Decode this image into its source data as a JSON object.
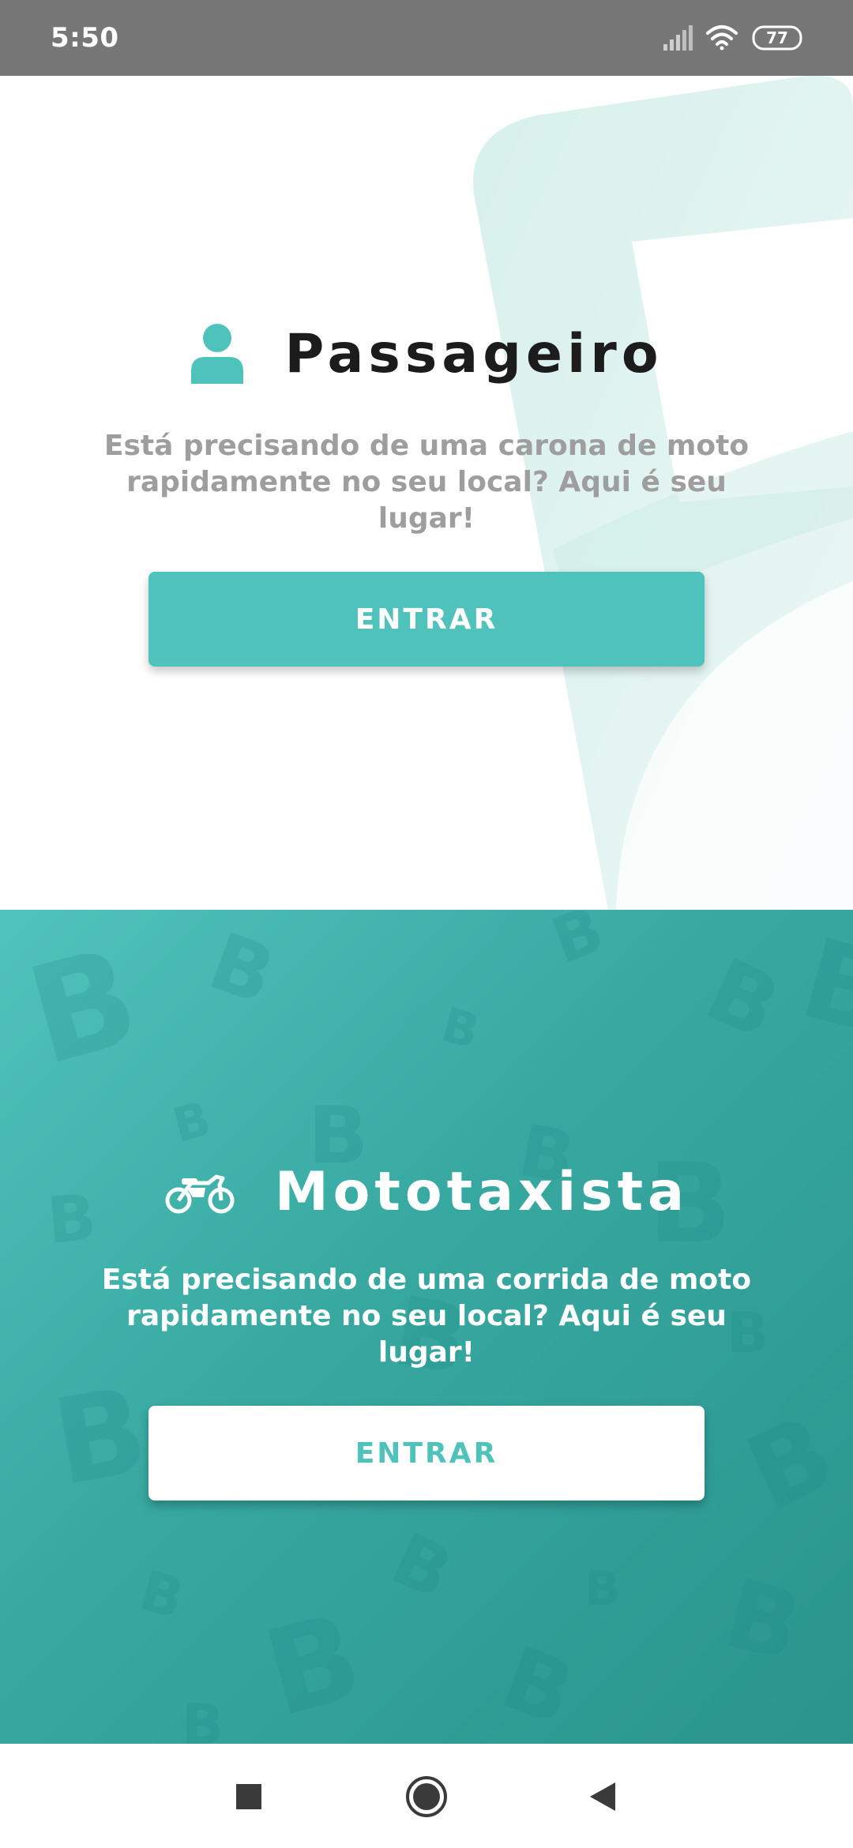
{
  "status_bar": {
    "time": "5:50",
    "battery": "77",
    "icons": [
      "signal-icon",
      "wifi-icon",
      "battery-icon"
    ]
  },
  "passenger": {
    "title": "Passageiro",
    "description": "Está precisando de uma carona de moto rapidamente no seu local? Aqui é seu lugar!",
    "button_label": "ENTRAR",
    "icon": "person-icon"
  },
  "driver": {
    "title": "Mototaxista",
    "description": "Está precisando de uma corrida de moto rapidamente no seu local? Aqui é seu lugar!",
    "button_label": "ENTRAR",
    "icon": "motorcycle-icon"
  },
  "nav_bar": {
    "icons": [
      "recents-square-icon",
      "home-circle-icon",
      "back-triangle-icon"
    ]
  },
  "colors": {
    "accent": "#4fc2bb",
    "status_bar": "#777777",
    "title_dark": "#1c1c1c",
    "desc_grey": "#9e9e9e"
  }
}
